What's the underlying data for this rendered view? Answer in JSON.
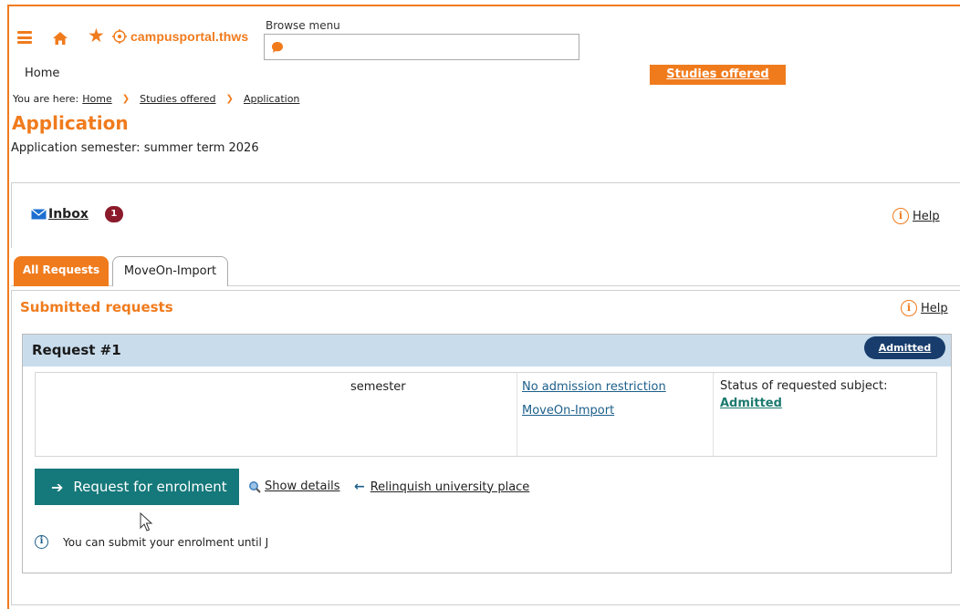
{
  "header": {
    "logo_text": "campusportal.thws",
    "browse_label": "Browse menu",
    "nav_home": "Home",
    "nav_studies": "Studies offered"
  },
  "breadcrumb": {
    "label": "You are here:",
    "items": [
      "Home",
      "Studies offered",
      "Application"
    ]
  },
  "page": {
    "title": "Application",
    "semester_text": "Application semester: summer term 2026"
  },
  "inbox": {
    "label": "Inbox",
    "count": "1",
    "help": "Help"
  },
  "tabs": {
    "all_requests": "All Requests",
    "moveon_import": "MoveOn-Import"
  },
  "submitted": {
    "title": "Submitted requests",
    "help": "Help"
  },
  "request": {
    "title": "Request #1",
    "status_pill": "Admitted",
    "semester": "semester",
    "restriction": "No admission restriction",
    "moveon": "MoveOn-Import",
    "status_label": "Status of requested subject:",
    "status_value": "Admitted",
    "enrol_button": "Request for enrolment",
    "show_details": "Show details",
    "relinquish": "Relinquish university place",
    "note": "You can submit your enrolment until J"
  },
  "colors": {
    "accent": "#f07b1d",
    "teal": "#15787a",
    "navy": "#183d6c",
    "header_blue": "#c8dcec",
    "badge": "#8b1a2b"
  },
  "icons": [
    "menu-icon",
    "home-icon",
    "star-icon",
    "logo-icon",
    "chat-icon",
    "mail-icon",
    "info-icon",
    "arrow-right-icon",
    "magnifier-icon",
    "arrow-left-icon",
    "cursor-icon"
  ]
}
